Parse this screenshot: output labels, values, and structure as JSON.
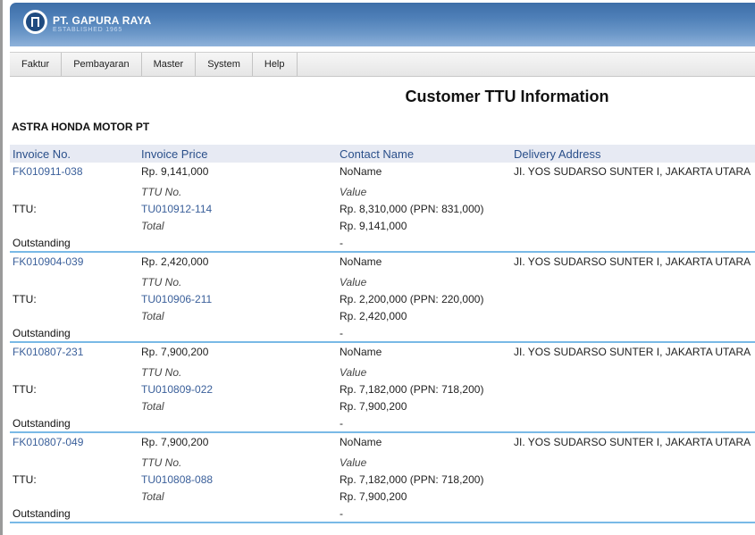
{
  "brand": {
    "name": "PT. GAPURA RAYA",
    "tagline": "ESTABLISHED 1965"
  },
  "menu": [
    "Faktur",
    "Pembayaran",
    "Master",
    "System",
    "Help"
  ],
  "page_title": "Customer TTU Information",
  "customer": "ASTRA HONDA MOTOR PT",
  "columns": {
    "invoice_no": "Invoice No.",
    "invoice_price": "Invoice Price",
    "contact_name": "Contact Name",
    "delivery_address": "Delivery Address"
  },
  "labels": {
    "ttu_no": "TTU No.",
    "value": "Value",
    "ttu": "TTU:",
    "total": "Total",
    "outstanding": "Outstanding"
  },
  "invoices": [
    {
      "invoice_no": "FK010911-038",
      "price": "Rp. 9,141,000",
      "contact": "NoName",
      "address": "JI. YOS SUDARSO SUNTER I, JAKARTA UTARA",
      "ttu_no": "TU010912-114",
      "value": "Rp. 8,310,000 (PPN: 831,000)",
      "total": "Rp. 9,141,000",
      "outstanding": "-"
    },
    {
      "invoice_no": "FK010904-039",
      "price": "Rp. 2,420,000",
      "contact": "NoName",
      "address": "JI. YOS SUDARSO SUNTER I, JAKARTA UTARA",
      "ttu_no": "TU010906-211",
      "value": "Rp. 2,200,000 (PPN: 220,000)",
      "total": "Rp. 2,420,000",
      "outstanding": "-"
    },
    {
      "invoice_no": "FK010807-231",
      "price": "Rp. 7,900,200",
      "contact": "NoName",
      "address": "JI. YOS SUDARSO SUNTER I, JAKARTA UTARA",
      "ttu_no": "TU010809-022",
      "value": "Rp. 7,182,000 (PPN: 718,200)",
      "total": "Rp. 7,900,200",
      "outstanding": "-"
    },
    {
      "invoice_no": "FK010807-049",
      "price": "Rp. 7,900,200",
      "contact": "NoName",
      "address": "JI. YOS SUDARSO SUNTER I, JAKARTA UTARA",
      "ttu_no": "TU010808-088",
      "value": "Rp. 7,182,000 (PPN: 718,200)",
      "total": "Rp. 7,900,200",
      "outstanding": "-"
    }
  ]
}
